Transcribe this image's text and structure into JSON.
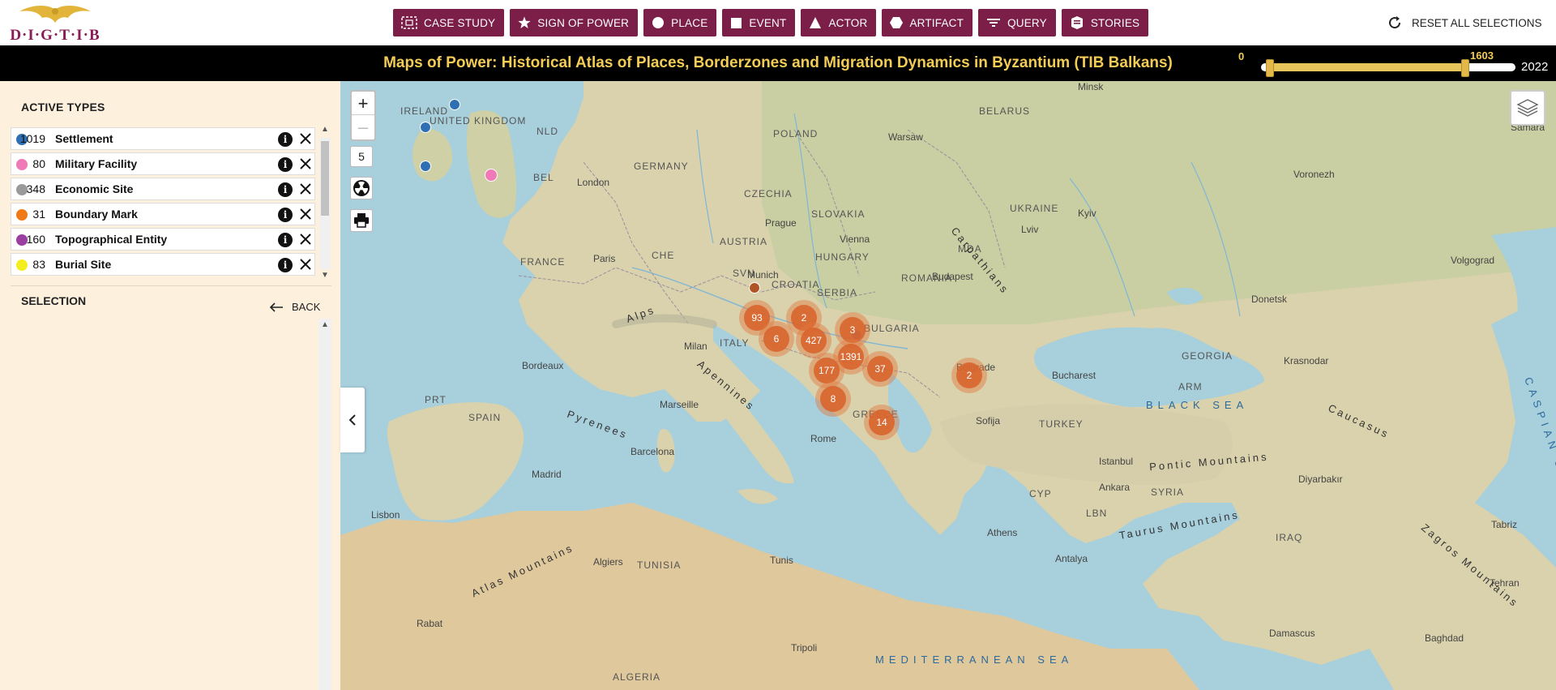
{
  "logo": {
    "text": "D·I·G·T·I·B"
  },
  "nav": {
    "case_study": "CASE STUDY",
    "sign_of_power": "SIGN OF POWER",
    "place": "PLACE",
    "event": "EVENT",
    "actor": "ACTOR",
    "artifact": "ARTIFACT",
    "query": "QUERY",
    "stories": "STORIES",
    "reset": "RESET ALL SELECTIONS"
  },
  "title": "Maps of Power: Historical Atlas of Places, Borderzones and Migration Dynamics in Byzantium (TIB Balkans)",
  "timeslider": {
    "min_value": "0",
    "max_value": "1603",
    "range_start": "0",
    "range_end": "2022",
    "selected_from": 0,
    "selected_to": 1603
  },
  "sidebar": {
    "active_types_heading": "ACTIVE TYPES",
    "selection_heading": "SELECTION",
    "back_label": "BACK",
    "types": [
      {
        "count": "1019",
        "label": "Settlement",
        "color": "#2f6fb3"
      },
      {
        "count": "80",
        "label": "Military Facility",
        "color": "#f07ab7"
      },
      {
        "count": "348",
        "label": "Economic Site",
        "color": "#9a9a9a"
      },
      {
        "count": "31",
        "label": "Boundary Mark",
        "color": "#f07a16"
      },
      {
        "count": "160",
        "label": "Topographical Entity",
        "color": "#9a3ea0"
      },
      {
        "count": "83",
        "label": "Burial Site",
        "color": "#f5ee1e"
      }
    ]
  },
  "map": {
    "zoom_in": "+",
    "zoom_out": "–",
    "zoom_level": "5",
    "clusters": [
      "93",
      "2",
      "6",
      "427",
      "3",
      "1391",
      "177",
      "37",
      "8",
      "14",
      "2"
    ],
    "labels": {
      "countries": [
        "IRELAND",
        "UNITED KINGDOM",
        "NLD",
        "BEL",
        "GERMANY",
        "POLAND",
        "BELARUS",
        "CZECHIA",
        "SLOVAKIA",
        "UKRAINE",
        "AUSTRIA",
        "HUNGARY",
        "MDA",
        "FRANCE",
        "CHE",
        "SVN",
        "CROATIA",
        "SERBIA",
        "ROMANIA",
        "BULGARIA",
        "ITALY",
        "SPAIN",
        "PRT",
        "GREECE",
        "TURKEY",
        "GEORGIA",
        "ARM",
        "SYRIA",
        "IRAQ",
        "LBN",
        "CYP",
        "TUNISIA",
        "ALGERIA"
      ],
      "cities": [
        "London",
        "Paris",
        "Warsaw",
        "Minsk",
        "Kyiv",
        "Voronezh",
        "Volgograd",
        "Prague",
        "Vienna",
        "Budapest",
        "Munich",
        "Milan",
        "Lviv",
        "Donetsk",
        "Bucharest",
        "Belgrade",
        "Sofija",
        "Rome",
        "Marseille",
        "Bordeaux",
        "Barcelona",
        "Madrid",
        "Lisbon",
        "Athens",
        "Ankara",
        "Istanbul",
        "Krasnodar",
        "Samara",
        "Rabat",
        "Algiers",
        "Tunis",
        "Tripoli",
        "Damascus",
        "Baghdad",
        "Diyarbakır",
        "Tabriz",
        "Tehran",
        "Antalya"
      ],
      "seas": [
        "BLACK SEA",
        "MEDITERRANEAN SEA",
        "CASPIAN SEA"
      ],
      "mountains": [
        "Carpathians",
        "Alps",
        "Apennines",
        "Pyrenees",
        "Atlas Mountains",
        "Pontic Mountains",
        "Taurus Mountains",
        "Caucasus",
        "Zagros Mountains"
      ]
    }
  }
}
